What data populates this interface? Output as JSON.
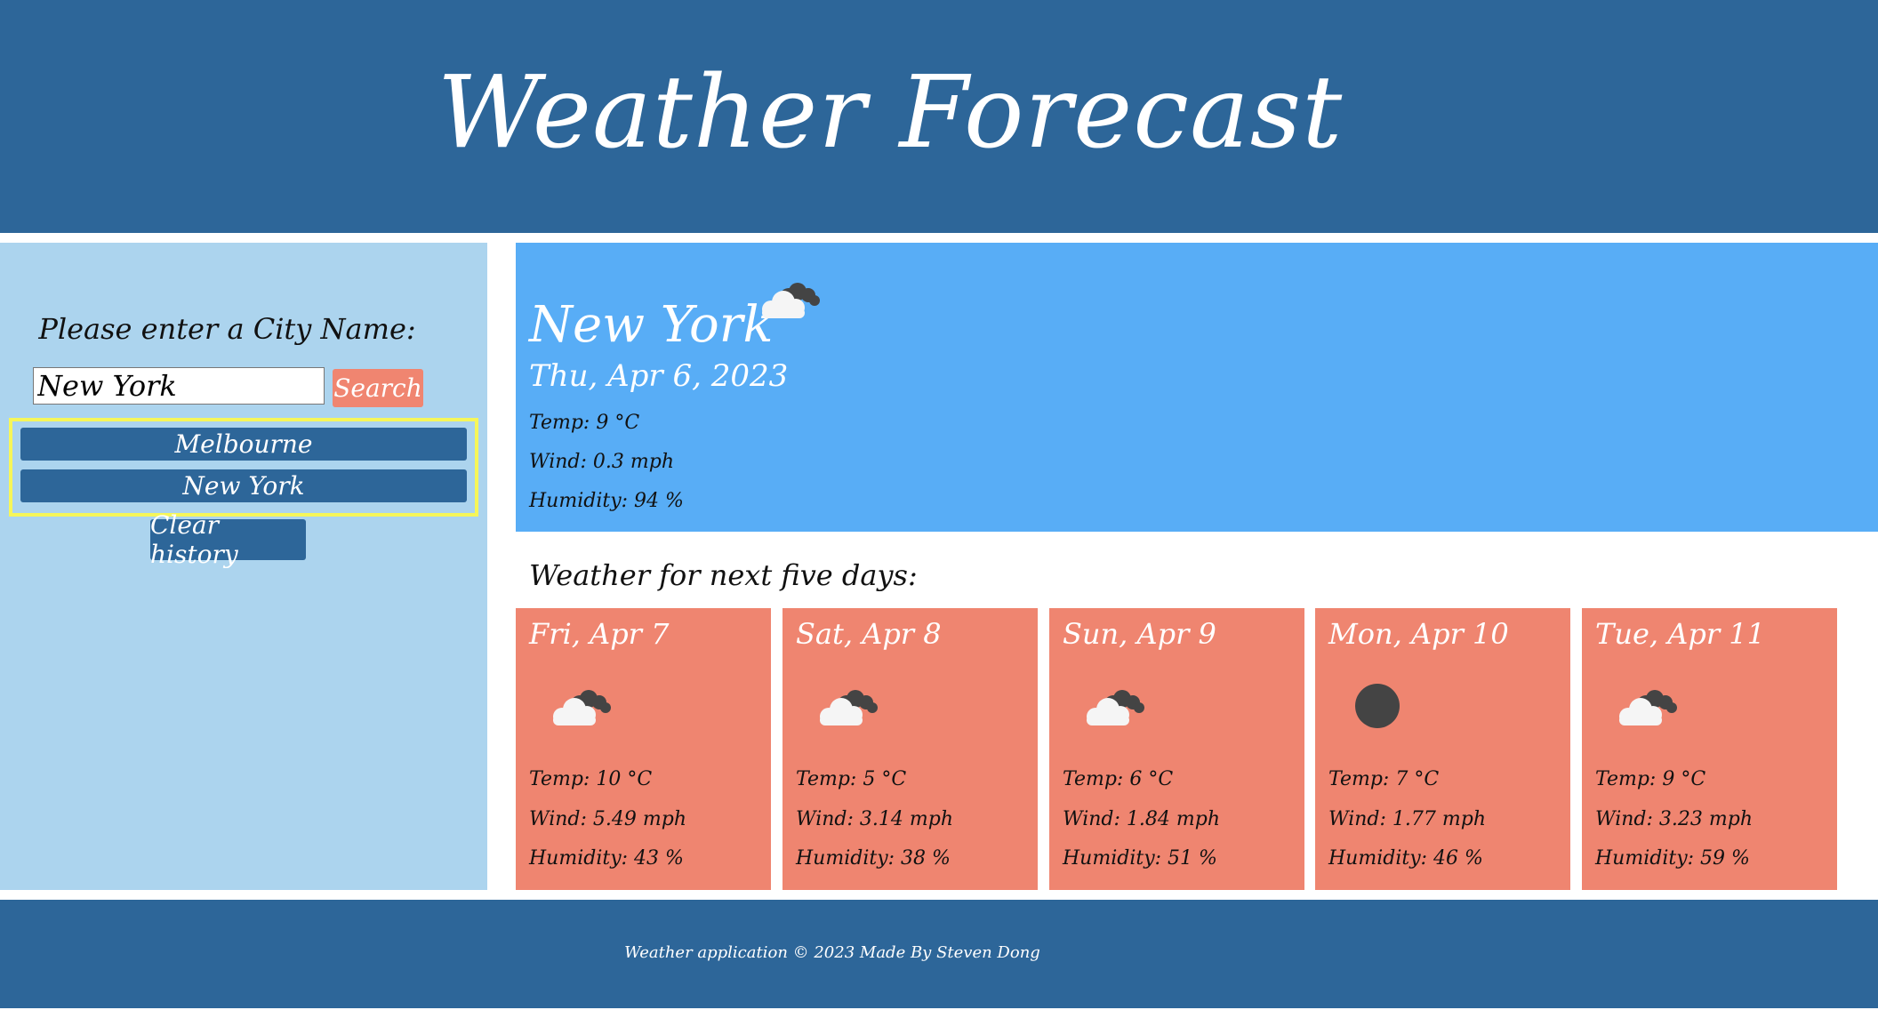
{
  "header": {
    "title": "Weather Forecast"
  },
  "sidebar": {
    "prompt": "Please enter a City Name:",
    "search_value": "New York",
    "search_label": "Search",
    "history": [
      "Melbourne",
      "New York"
    ],
    "clear_label": "Clear history"
  },
  "current": {
    "city": "New York",
    "date": "Thu, Apr 6, 2023",
    "icon": "cloud-icon",
    "temp": "Temp: 9 °C",
    "wind": "Wind: 0.3 mph",
    "humidity": "Humidity: 94 %"
  },
  "forecast": {
    "title": "Weather for next five days:",
    "days": [
      {
        "day": "Fri, Apr 7",
        "icon": "cloud-icon",
        "temp": "Temp: 10 °C",
        "wind": "Wind: 5.49 mph",
        "humidity": "Humidity: 43 %"
      },
      {
        "day": "Sat, Apr 8",
        "icon": "cloud-icon",
        "temp": "Temp: 5 °C",
        "wind": "Wind: 3.14 mph",
        "humidity": "Humidity: 38 %"
      },
      {
        "day": "Sun, Apr 9",
        "icon": "cloud-icon",
        "temp": "Temp: 6 °C",
        "wind": "Wind: 1.84 mph",
        "humidity": "Humidity: 51 %"
      },
      {
        "day": "Mon, Apr 10",
        "icon": "dark-circle-icon",
        "temp": "Temp: 7 °C",
        "wind": "Wind: 1.77 mph",
        "humidity": "Humidity: 46 %"
      },
      {
        "day": "Tue, Apr 11",
        "icon": "cloud-icon",
        "temp": "Temp: 9 °C",
        "wind": "Wind: 3.23 mph",
        "humidity": "Humidity: 59 %"
      }
    ]
  },
  "footer": {
    "text": "Weather application © 2023 Made By Steven Dong"
  },
  "colors": {
    "primary": "#2d6699",
    "sidebar": "#acd4ee",
    "current_bg": "#58adf6",
    "card_bg": "#ef8570",
    "highlight": "#f6f659"
  }
}
